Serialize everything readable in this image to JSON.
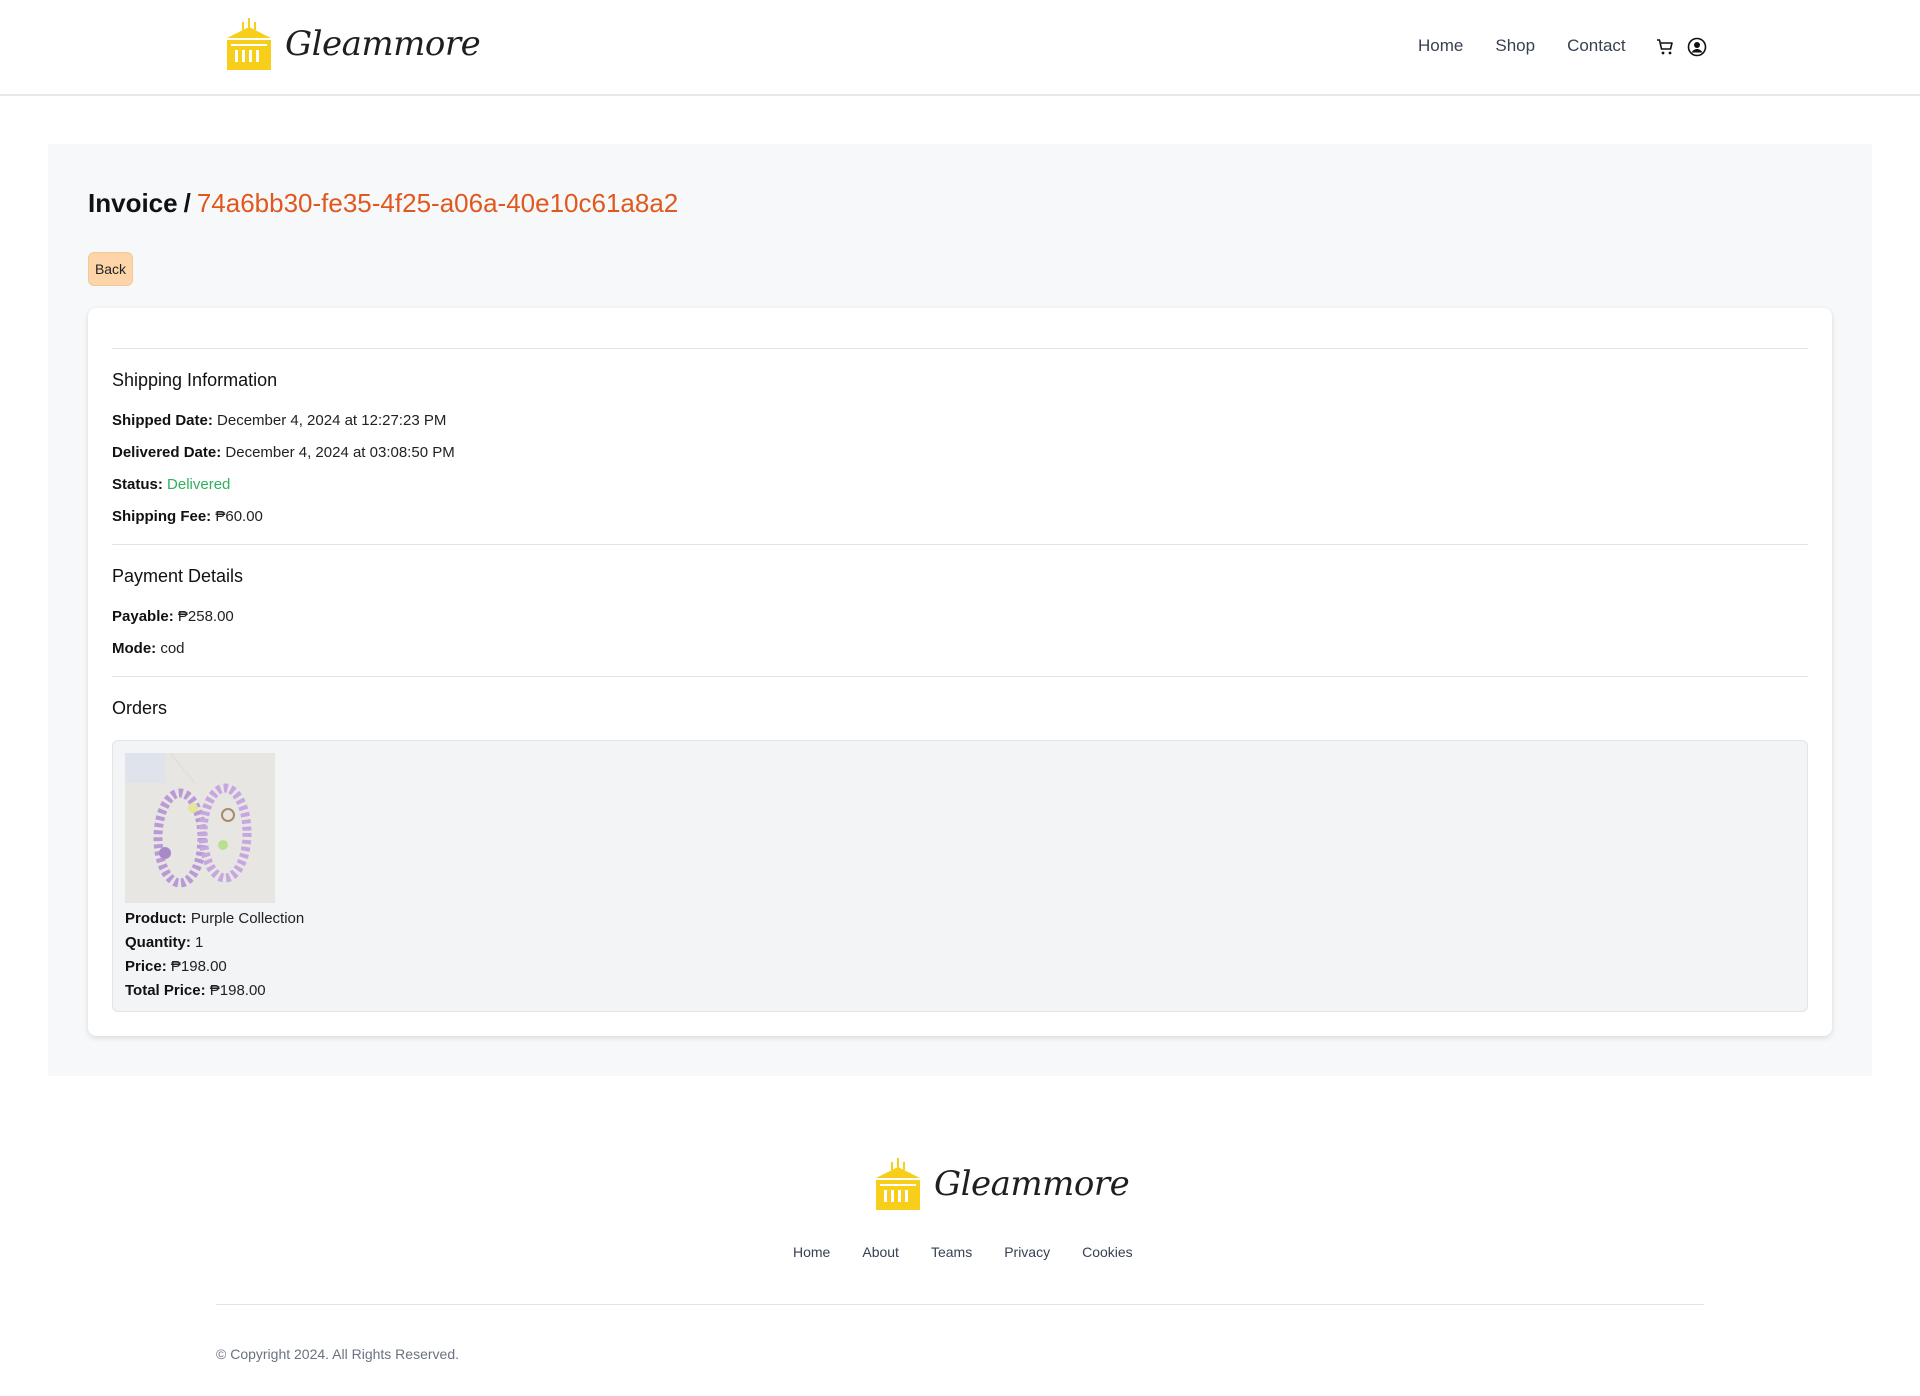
{
  "header": {
    "brand_name": "Gleammore",
    "nav": [
      "Home",
      "Shop",
      "Contact"
    ],
    "icons": [
      "cart-icon",
      "user-circle-icon"
    ]
  },
  "invoice": {
    "title": "Invoice",
    "separator": "/",
    "id": "74a6bb30-fe35-4f25-a06a-40e10c61a8a2",
    "back_label": "Back"
  },
  "shipping": {
    "title": "Shipping Information",
    "shipped_label": "Shipped Date:",
    "shipped_value": "December 4, 2024 at 12:27:23 PM",
    "delivered_label": "Delivered Date:",
    "delivered_value": "December 4, 2024 at 03:08:50 PM",
    "status_label": "Status:",
    "status_value": "Delivered",
    "fee_label": "Shipping Fee:",
    "fee_value": "₱60.00"
  },
  "payment": {
    "title": "Payment Details",
    "payable_label": "Payable:",
    "payable_value": "₱258.00",
    "mode_label": "Mode:",
    "mode_value": "cod"
  },
  "orders": {
    "title": "Orders",
    "items": [
      {
        "product_label": "Product:",
        "product_value": "Purple Collection",
        "quantity_label": "Quantity:",
        "quantity_value": "1",
        "price_label": "Price:",
        "price_value": "₱198.00",
        "total_label": "Total Price:",
        "total_value": "₱198.00"
      }
    ]
  },
  "footer": {
    "brand_name": "Gleammore",
    "nav": [
      "Home",
      "About",
      "Teams",
      "Privacy",
      "Cookies"
    ],
    "copyright": "© Copyright 2024. All Rights Reserved."
  },
  "colors": {
    "accent_id": "#e0581e",
    "status_delivered": "#2fb05c",
    "back_button": "#fdd5a8",
    "brand_yellow": "#f7cf1a"
  }
}
